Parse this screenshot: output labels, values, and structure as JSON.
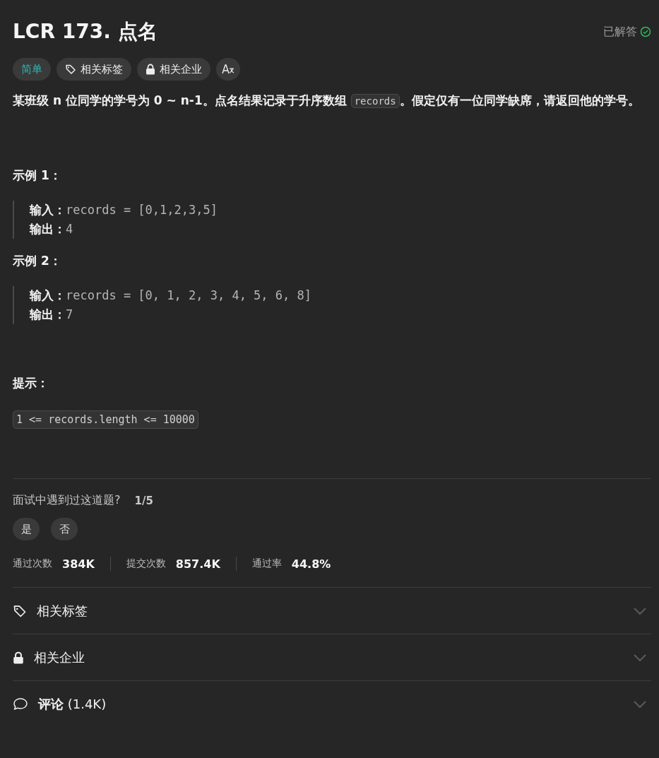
{
  "title": "LCR 173. 点名",
  "status": {
    "label": "已解答",
    "solved": true
  },
  "tags": [
    {
      "kind": "difficulty",
      "label": "简单"
    },
    {
      "kind": "tag",
      "label": "相关标签"
    },
    {
      "kind": "lock",
      "label": "相关企业"
    },
    {
      "kind": "translate"
    }
  ],
  "description": [
    {
      "kind": "text",
      "text": "某班级 n 位同学的学号为 0 ~ n-1。点名结果记录于升序数组 "
    },
    {
      "kind": "code",
      "text": "records"
    },
    {
      "kind": "text",
      "text": "。假定仅有一位同学缺席，请返回他的学号。"
    }
  ],
  "examples": [
    {
      "heading": "示例 1：",
      "lines": [
        {
          "label": "输入：",
          "value": "records = [0,1,2,3,5]"
        },
        {
          "label": "输出：",
          "value": "4"
        }
      ]
    },
    {
      "heading": "示例 2：",
      "lines": [
        {
          "label": "输入：",
          "value": "records = [0, 1, 2, 3, 4, 5, 6, 8]"
        },
        {
          "label": "输出：",
          "value": "7"
        }
      ]
    }
  ],
  "hints": {
    "heading": "提示：",
    "items": [
      "1 <= records.length <= 10000"
    ]
  },
  "interview": {
    "question": "面试中遇到过这道题?",
    "count": "1/5",
    "options": [
      "是",
      "否"
    ]
  },
  "stats": [
    {
      "label": "通过次数",
      "value": "384K"
    },
    {
      "label": "提交次数",
      "value": "857.4K"
    },
    {
      "label": "通过率",
      "value": "44.8%"
    }
  ],
  "sections": [
    {
      "kind": "tag",
      "label": "相关标签",
      "expanded": false
    },
    {
      "kind": "lock",
      "label": "相关企业",
      "expanded": false
    },
    {
      "kind": "comment",
      "label": "**评论** (1.4K)",
      "expanded": false
    }
  ]
}
